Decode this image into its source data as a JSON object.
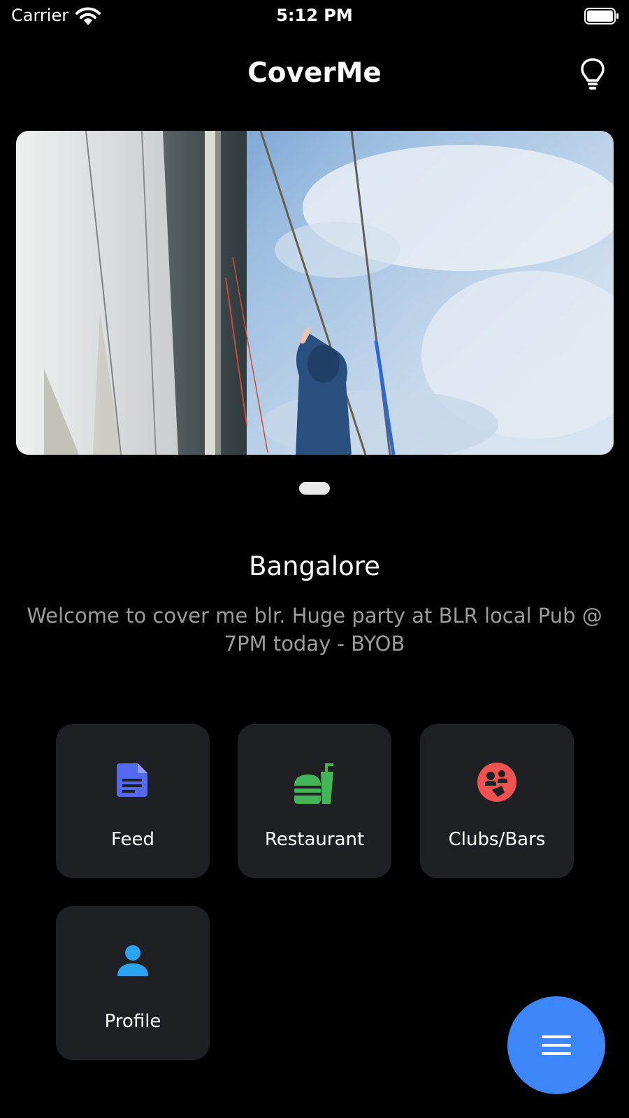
{
  "status_bar": {
    "carrier": "Carrier",
    "time": "5:12 PM"
  },
  "nav": {
    "title": "CoverMe"
  },
  "city": {
    "name": "Bangalore",
    "message": "Welcome to cover me blr. Huge party at BLR local Pub @ 7PM today - BYOB"
  },
  "tiles": [
    {
      "label": "Feed",
      "icon": "document-icon",
      "color": "#5568f0"
    },
    {
      "label": "Restaurant",
      "icon": "fastfood-icon",
      "color": "#43b556"
    },
    {
      "label": "Clubs/Bars",
      "icon": "party-icon",
      "color": "#f05252"
    },
    {
      "label": "Profile",
      "icon": "person-icon",
      "color": "#2aa3f0"
    }
  ],
  "colors": {
    "background": "#000000",
    "tile": "#1f2023",
    "fab": "#3d86f7"
  }
}
